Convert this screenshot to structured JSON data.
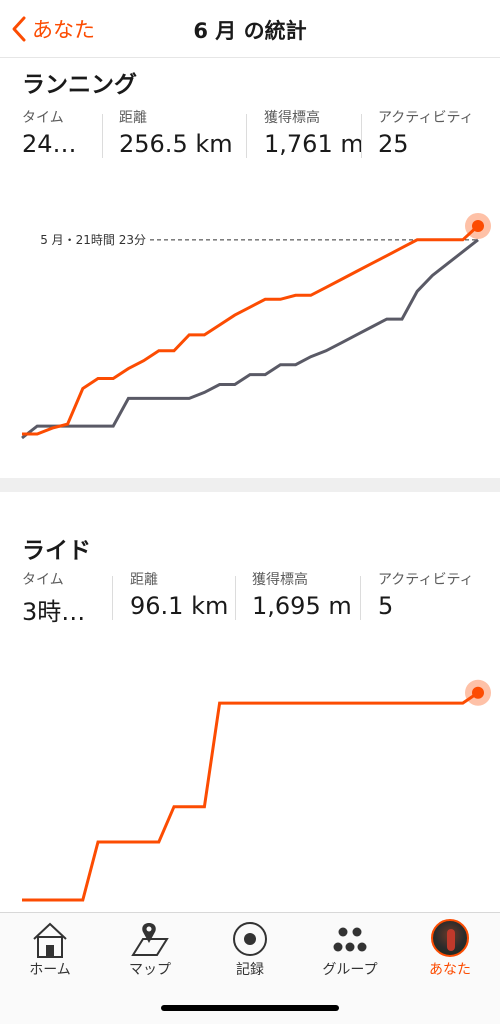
{
  "header": {
    "back_label": "あなた",
    "title": "6 月 の統計"
  },
  "colors": {
    "accent": "#fc4c02",
    "previous_month_line": "#5a5a66",
    "reference_line": "#333333"
  },
  "running": {
    "title": "ランニング",
    "stats": [
      {
        "label": "タイム",
        "value": "24…"
      },
      {
        "label": "距離",
        "value": "256.5 km"
      },
      {
        "label": "獲得標高",
        "value": "1,761 m"
      },
      {
        "label": "アクティビティ",
        "value": "25"
      }
    ],
    "reference_label": "5 月・21時間 23分"
  },
  "ride": {
    "title": "ライド",
    "stats": [
      {
        "label": "タイム",
        "value": "3時…"
      },
      {
        "label": "距離",
        "value": "96.1 km"
      },
      {
        "label": "獲得標高",
        "value": "1,695 m"
      },
      {
        "label": "アクティビティ",
        "value": "5"
      }
    ]
  },
  "chart_data": [
    {
      "type": "line",
      "title": "",
      "xlabel": "",
      "ylabel": "",
      "grid": false,
      "reference_line": {
        "label": "5 月・21時間 23分",
        "value": 100
      },
      "ylim": [
        0,
        110
      ],
      "xlim": [
        0,
        30
      ],
      "series": [
        {
          "x": [
            0,
            1,
            2,
            3,
            4,
            5,
            6,
            7,
            8,
            9,
            10,
            11,
            12,
            13,
            14,
            15,
            16,
            17,
            18,
            19,
            20,
            21,
            22,
            23,
            24,
            25,
            26,
            27,
            28,
            29,
            30
          ],
          "values": [
            2,
            2,
            5,
            7,
            25,
            30,
            30,
            35,
            39,
            44,
            44,
            52,
            52,
            57,
            62,
            66,
            70,
            70,
            72,
            72,
            76,
            80,
            84,
            88,
            92,
            96,
            100,
            100,
            100,
            100,
            107
          ]
        },
        {
          "x": [
            0,
            1,
            2,
            3,
            4,
            5,
            6,
            7,
            8,
            9,
            10,
            11,
            12,
            13,
            14,
            15,
            16,
            17,
            18,
            19,
            20,
            21,
            22,
            23,
            24,
            25,
            26,
            27,
            28,
            29,
            30
          ],
          "values": [
            0,
            6,
            6,
            6,
            6,
            6,
            6,
            20,
            20,
            20,
            20,
            20,
            23,
            27,
            27,
            32,
            32,
            37,
            37,
            41,
            44,
            48,
            52,
            56,
            60,
            60,
            74,
            82,
            88,
            94,
            100
          ]
        }
      ]
    },
    {
      "type": "line",
      "title": "",
      "xlabel": "",
      "ylabel": "",
      "grid": false,
      "ylim": [
        0,
        110
      ],
      "xlim": [
        0,
        30
      ],
      "series": [
        {
          "x": [
            0,
            1,
            2,
            3,
            4,
            5,
            6,
            7,
            8,
            9,
            10,
            11,
            12,
            13,
            14,
            15,
            16,
            17,
            18,
            19,
            20,
            21,
            22,
            23,
            24,
            25,
            26,
            27,
            28,
            29,
            30
          ],
          "values": [
            0,
            0,
            0,
            0,
            0,
            28,
            28,
            28,
            28,
            28,
            45,
            45,
            45,
            95,
            95,
            95,
            95,
            95,
            95,
            95,
            95,
            95,
            95,
            95,
            95,
            95,
            95,
            95,
            95,
            95,
            100
          ]
        }
      ]
    }
  ]
}
